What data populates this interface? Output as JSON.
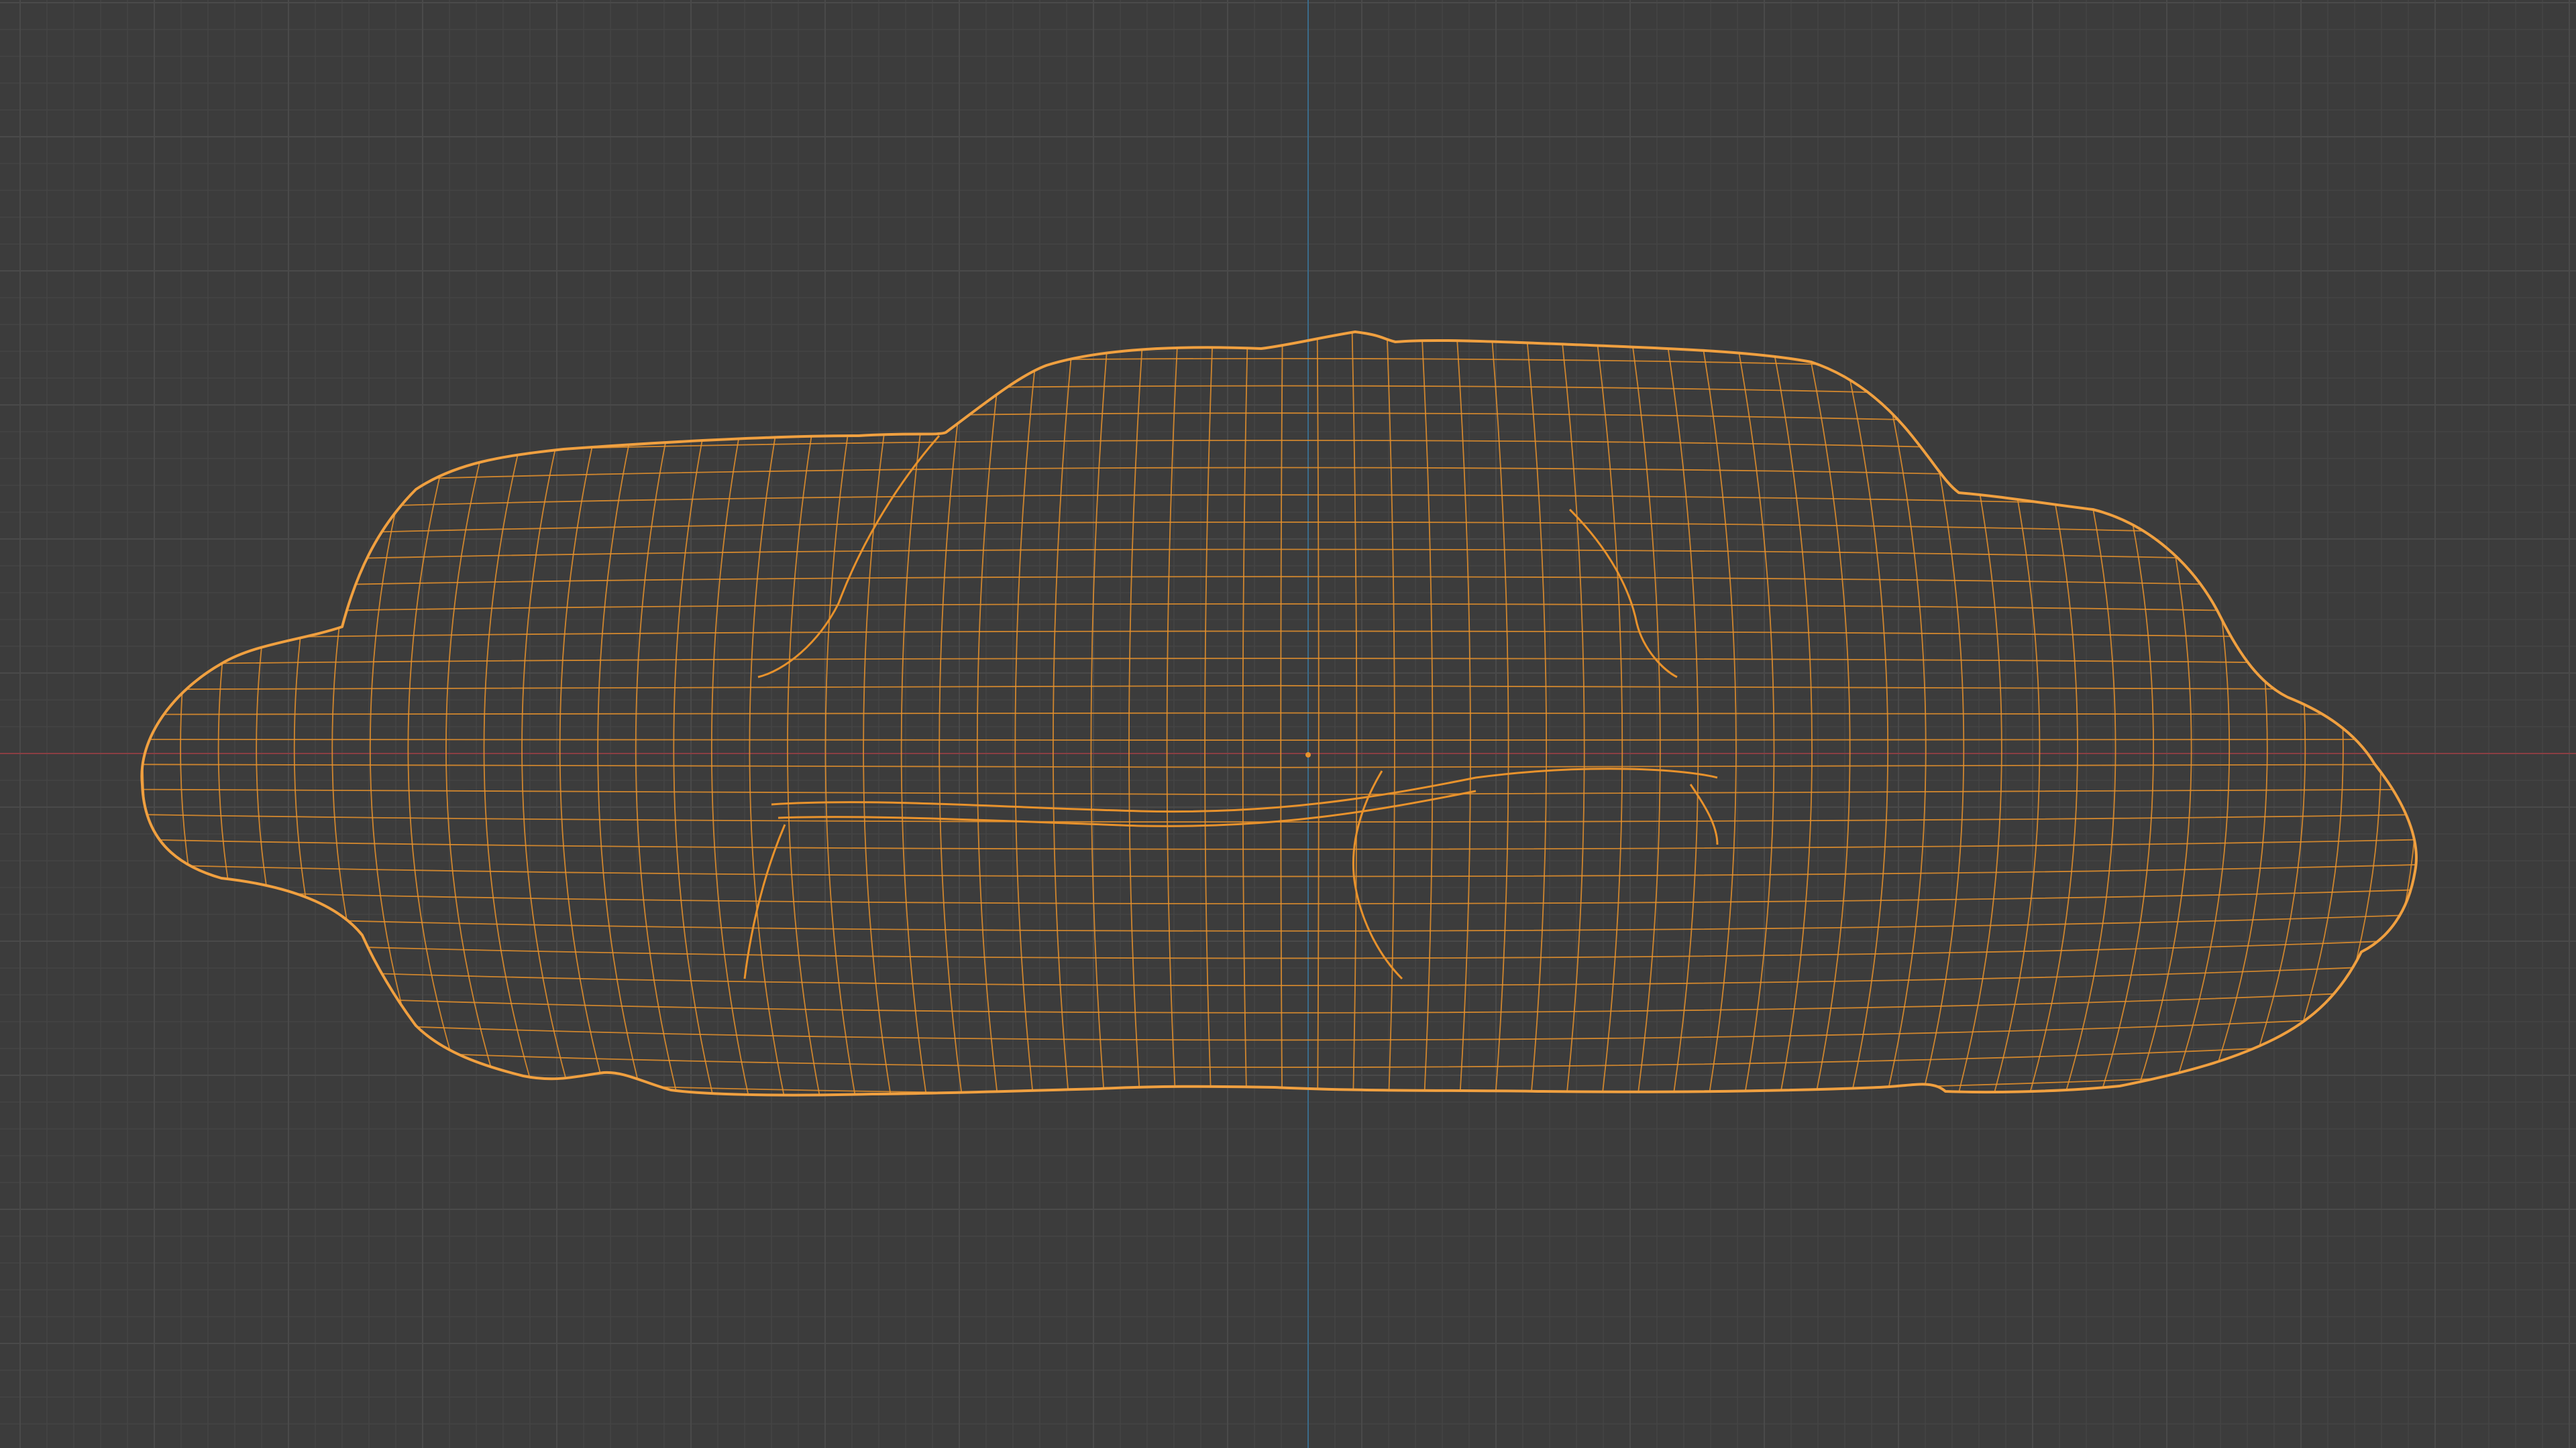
{
  "viewport": {
    "background_color": "#3c3c3c",
    "grid_minor_color": "#444444",
    "grid_major_color": "#4a4a4a",
    "x_axis_color": "#8a3f43",
    "y_axis_color": "#3b6b8a",
    "wireframe_color": "#e8922c",
    "selection_outline_color": "#f0a040",
    "shading_mode": "wireframe",
    "selected_object": "mesh-object",
    "view_axis": "front"
  }
}
